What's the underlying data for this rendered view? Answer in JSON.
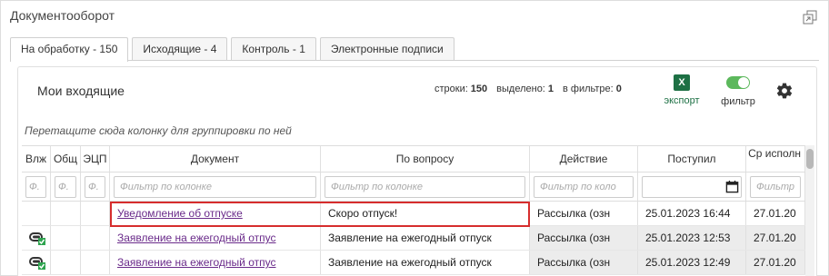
{
  "panel": {
    "title": "Документооборот",
    "restore_icon": "restore-window-icon"
  },
  "tabs": [
    {
      "label": "На обработку - 150",
      "active": true
    },
    {
      "label": "Исходящие - 4",
      "active": false
    },
    {
      "label": "Контроль - 1",
      "active": false
    },
    {
      "label": "Электронные подписи",
      "active": false
    }
  ],
  "list": {
    "title": "Мои входящие",
    "stats": {
      "rows_label": "строки:",
      "rows_value": "150",
      "selected_label": "выделено:",
      "selected_value": "1",
      "filtered_label": "в фильтре:",
      "filtered_value": "0"
    },
    "export_label": "экспорт",
    "export_icon_text": "X",
    "filter_label": "фильтр",
    "filter_on": true,
    "settings_icon": "gear-icon",
    "group_hint": "Перетащите сюда колонку для группировки по ней"
  },
  "grid": {
    "columns": [
      "Влж",
      "Общ",
      "ЭЦП",
      "Документ",
      "По вопросу",
      "Действие",
      "Поступил",
      "Ср исполн"
    ],
    "filter_placeholder": "Фильтр по колонке",
    "filter_short": "Ф.",
    "filter_trunc_action": "Фильтр по коло",
    "filter_trunc_last": "Фильтр",
    "rows": [
      {
        "attach": false,
        "document": "Уведомление об отпуске",
        "question": "Скоро отпуск!",
        "action": "Рассылка (озн",
        "received": "25.01.2023 16:44",
        "due": "27.01.20"
      },
      {
        "attach": true,
        "document": "Заявление на ежегодный отпус",
        "question": "Заявление на ежегодный отпуск",
        "action": "Рассылка (озн",
        "received": "25.01.2023 12:53",
        "due": "27.01.20"
      },
      {
        "attach": true,
        "document": "Заявление на ежегодный отпус",
        "question": "Заявление на ежегодный отпуск",
        "action": "Рассылка (озн",
        "received": "25.01.2023 12:49",
        "due": "27.01.20"
      }
    ],
    "colors": {
      "accent_link": "#6a2b8a",
      "highlight": "#d62d2d",
      "excel": "#1d7044",
      "toggle": "#5cb85c"
    }
  }
}
